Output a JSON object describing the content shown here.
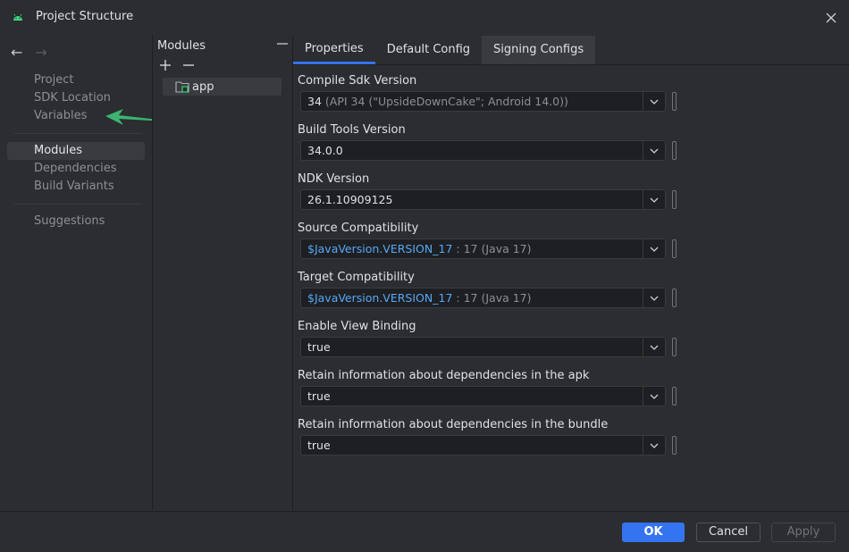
{
  "window": {
    "title": "Project Structure"
  },
  "nav": {
    "back": "←",
    "forward": "→",
    "items": [
      {
        "label": "Project"
      },
      {
        "label": "SDK Location"
      },
      {
        "label": "Variables"
      },
      {
        "label": "Modules"
      },
      {
        "label": "Dependencies"
      },
      {
        "label": "Build Variants"
      },
      {
        "label": "Suggestions"
      }
    ],
    "selected": "Modules"
  },
  "modules": {
    "header": "Modules",
    "items": [
      {
        "label": "app"
      }
    ]
  },
  "tabs": [
    {
      "label": "Properties",
      "active": true
    },
    {
      "label": "Default Config",
      "active": false
    },
    {
      "label": "Signing Configs",
      "active": false
    }
  ],
  "fields": [
    {
      "label": "Compile Sdk Version",
      "value": "34",
      "hint": "(API 34 (\"UpsideDownCake\"; Android 14.0))"
    },
    {
      "label": "Build Tools Version",
      "value": "34.0.0"
    },
    {
      "label": "NDK Version",
      "value": "26.1.10909125"
    },
    {
      "label": "Source Compatibility",
      "link": "$JavaVersion.VERSION_17",
      "value": ": 17",
      "hint": "(Java 17)"
    },
    {
      "label": "Target Compatibility",
      "link": "$JavaVersion.VERSION_17",
      "value": ": 17",
      "hint": "(Java 17)"
    },
    {
      "label": "Enable View Binding",
      "value": "true"
    },
    {
      "label": "Retain information about dependencies in the apk",
      "value": "true"
    },
    {
      "label": "Retain information about dependencies in the bundle",
      "value": "true"
    }
  ],
  "footer": {
    "ok": "OK",
    "cancel": "Cancel",
    "apply": "Apply"
  },
  "colors": {
    "accent": "#3574f0",
    "link": "#56a8f5",
    "annotation_arrow": "#3cb371",
    "android_icon": "#3ddc84"
  }
}
